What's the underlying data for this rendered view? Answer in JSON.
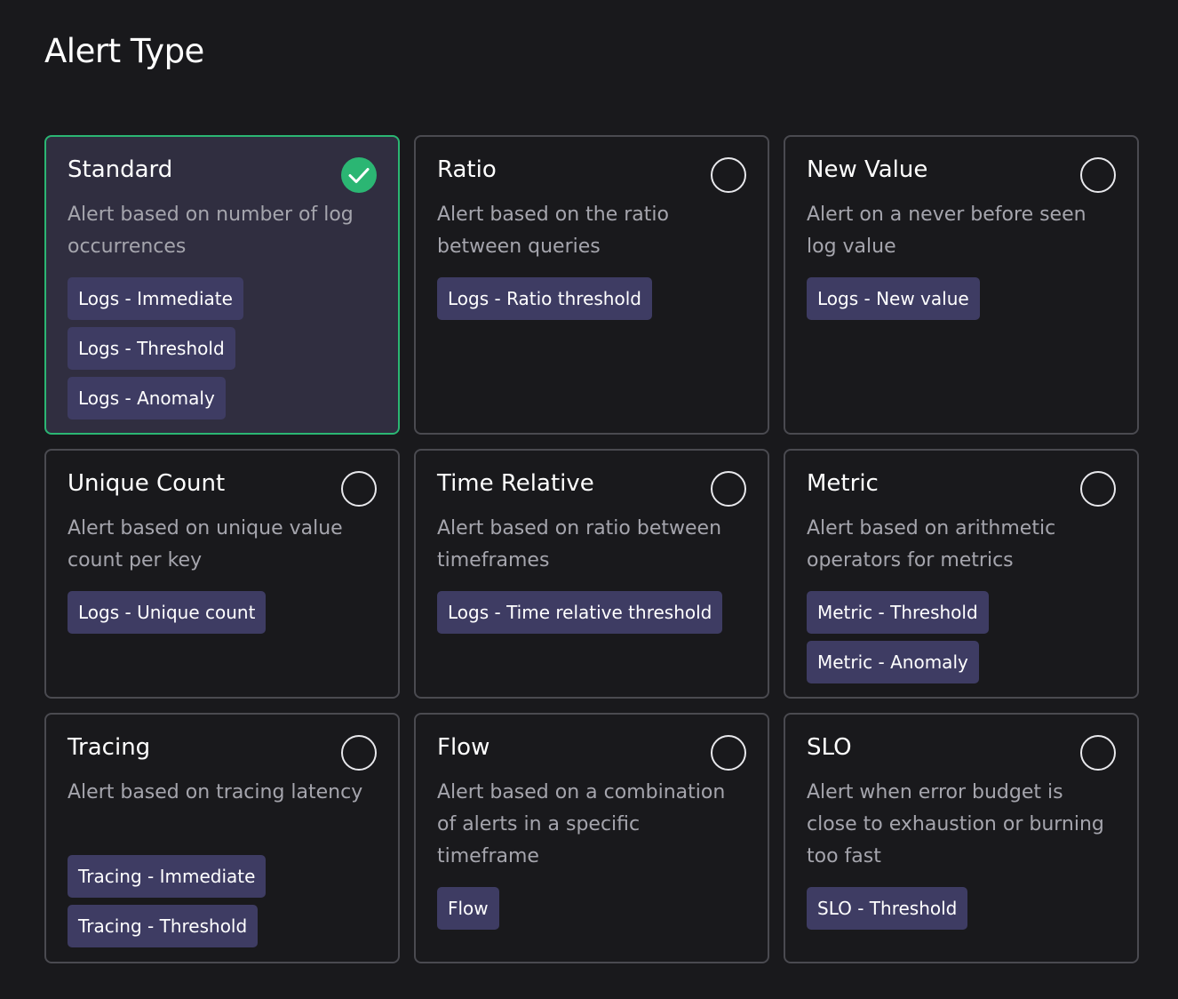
{
  "title": "Alert Type",
  "colors": {
    "selected_border": "#2bb673",
    "tag_bg": "#3e3c63",
    "card_border": "#4a4a50"
  },
  "cards": [
    {
      "title": "Standard",
      "description": "Alert based on number of log occurrences",
      "selected": true,
      "tags": [
        "Logs - Immediate",
        "Logs - Threshold",
        "Logs - Anomaly"
      ]
    },
    {
      "title": "Ratio",
      "description": "Alert based on the ratio between queries",
      "selected": false,
      "tags": [
        "Logs - Ratio threshold"
      ]
    },
    {
      "title": "New Value",
      "description": "Alert on a never before seen log value",
      "selected": false,
      "tags": [
        "Logs - New value"
      ]
    },
    {
      "title": "Unique Count",
      "description": "Alert based on unique value count per key",
      "selected": false,
      "tags": [
        "Logs - Unique count"
      ]
    },
    {
      "title": "Time Relative",
      "description": "Alert based on ratio between timeframes",
      "selected": false,
      "tags": [
        "Logs - Time relative threshold"
      ]
    },
    {
      "title": "Metric",
      "description": "Alert based on arithmetic operators for metrics",
      "selected": false,
      "tags": [
        "Metric - Threshold",
        "Metric - Anomaly"
      ]
    },
    {
      "title": "Tracing",
      "description": "Alert based on tracing latency",
      "selected": false,
      "tags": [
        "Tracing - Immediate",
        "Tracing - Threshold"
      ]
    },
    {
      "title": "Flow",
      "description": "Alert based on a combination of alerts in a specific timeframe",
      "selected": false,
      "tags": [
        "Flow"
      ]
    },
    {
      "title": "SLO",
      "description": "Alert when error budget is close to exhaustion or burning too fast",
      "selected": false,
      "tags": [
        "SLO - Threshold"
      ]
    }
  ]
}
